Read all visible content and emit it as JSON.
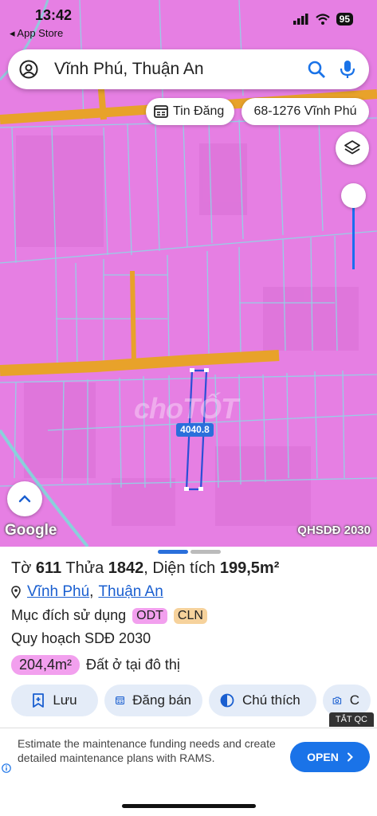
{
  "status": {
    "time": "13:42",
    "back_app": "App Store",
    "battery": "95"
  },
  "search": {
    "query": "Vĩnh Phú, Thuận An"
  },
  "chips": {
    "listing": "Tin Đăng",
    "code": "68-1276 Vĩnh Phú"
  },
  "map": {
    "parcel_label": "4040.8",
    "watermark": "choTỐT",
    "provider": "Google",
    "layer_name": "QHSDĐ 2030",
    "slider_level": 0.0
  },
  "parcel": {
    "prefix_to": "Tờ ",
    "sheet": "611",
    "prefix_thua": " Thửa ",
    "lot": "1842",
    "prefix_area": ", Diện tích ",
    "area": "199,5m²",
    "ward": "Vĩnh Phú",
    "city": "Thuận An",
    "purpose_label": "Mục đích sử dụng",
    "purpose_codes": [
      "ODT",
      "CLN"
    ],
    "plan_label": "Quy hoạch SDĐ 2030",
    "plan_area": "204,4m²",
    "plan_type": "Đất ở tại đô thị"
  },
  "actions": {
    "save": "Lưu",
    "post": "Đăng bán",
    "legend": "Chú thích",
    "photo": "C"
  },
  "ad": {
    "close_label": "TẮT QC",
    "text": "Estimate the maintenance funding needs and create detailed maintenance plans with RAMS.",
    "cta": "OPEN"
  },
  "colors": {
    "map_pink": "#e67fe3",
    "road": "#e8a22a",
    "accent": "#1a73e8",
    "parcel_border": "#2a6fdb"
  }
}
